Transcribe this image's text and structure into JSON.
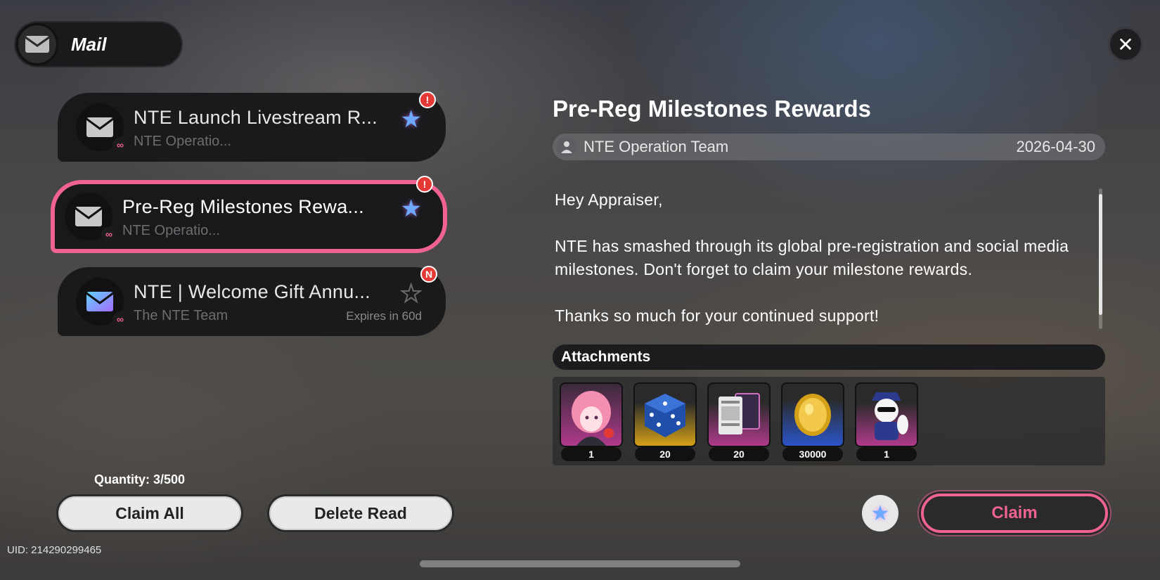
{
  "header": {
    "title": "Mail",
    "icon": "envelope-icon"
  },
  "close_icon": "close-icon",
  "mails": [
    {
      "subject": "NTE Launch Livestream R...",
      "sender": "NTE Operatio...",
      "starred": true,
      "badge": "!",
      "expires": ""
    },
    {
      "subject": "Pre-Reg Milestones Rewa...",
      "sender": "NTE Operatio...",
      "starred": true,
      "badge": "!",
      "expires": ""
    },
    {
      "subject": "NTE | Welcome Gift Annu...",
      "sender": "The NTE Team",
      "starred": false,
      "badge": "N",
      "expires": "Expires in 60d"
    }
  ],
  "footer": {
    "quantity": "Quantity: 3/500",
    "claim_all": "Claim All",
    "delete_read": "Delete Read",
    "uid": "UID: 214290299465"
  },
  "detail": {
    "title": "Pre-Reg Milestones Rewards",
    "sender": "NTE Operation Team",
    "date": "2026-04-30",
    "greeting": "Hey Appraiser,",
    "paragraph": "NTE has smashed through its global pre-registration and social media milestones. Don't forget to claim your milestone rewards.",
    "paragraph2": "Thanks so much for your continued support!",
    "attachments_label": "Attachments",
    "attachments": [
      {
        "name": "character-avatar",
        "qty": "1",
        "rarity_color": "#b03a8c"
      },
      {
        "name": "blue-dice",
        "qty": "20",
        "rarity_color": "#d4a017"
      },
      {
        "name": "trading-card",
        "qty": "20",
        "rarity_color": "#b03a8c"
      },
      {
        "name": "gold-coin",
        "qty": "30000",
        "rarity_color": "#2b55c8"
      },
      {
        "name": "panda-figure",
        "qty": "1",
        "rarity_color": "#b03a8c"
      }
    ],
    "claim_label": "Claim"
  },
  "colors": {
    "accent": "#f06292",
    "star": "#6ea8ff",
    "badge": "#e53935"
  }
}
